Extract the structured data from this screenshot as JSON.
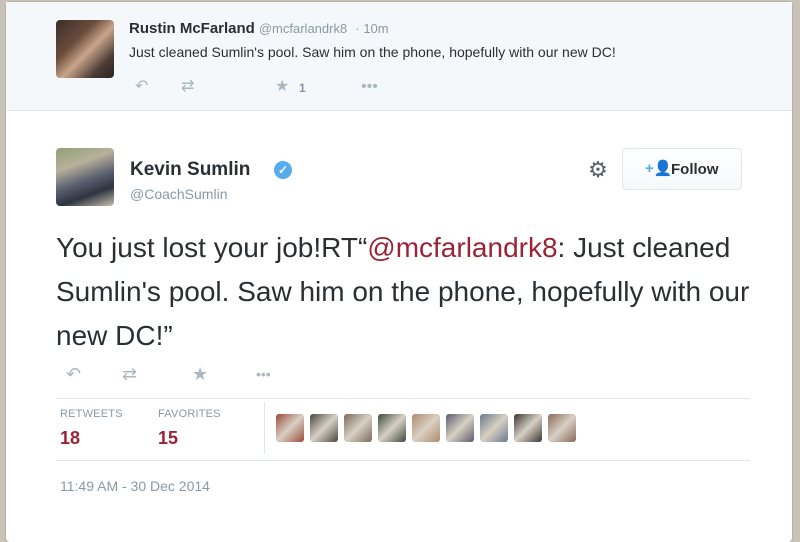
{
  "reply": {
    "fullname": "Rustin McFarland",
    "handle": "@mcfarlandrk8",
    "time": "· 10m",
    "text": "Just cleaned Sumlin's pool. Saw him on the phone, hopefully with our new DC!",
    "favorite_count": "1",
    "icons": [
      "reply-icon",
      "retweet-icon",
      "star-icon",
      "more-icon"
    ]
  },
  "main": {
    "fullname": "Kevin Sumlin",
    "handle": "@CoachSumlin",
    "follow_label": "Follow",
    "text_before": "You just lost your job!RT“",
    "mention": "@mcfarlandrk8",
    "text_after": ": Just cleaned Sumlin's pool. Saw him on the phone, hopefully with our new DC!”",
    "stats": {
      "retweets_label": "RETWEETS",
      "retweets": "18",
      "favorites_label": "FAVORITES",
      "favorites": "15"
    },
    "favoriters": [
      {
        "color": "#9a4a3a"
      },
      {
        "color": "#4a4640"
      },
      {
        "color": "#7a6a5c"
      },
      {
        "color": "#3d4a3e"
      },
      {
        "color": "#b08a6a"
      },
      {
        "color": "#5a5a6a"
      },
      {
        "color": "#6a7a8a"
      },
      {
        "color": "#3a3632"
      },
      {
        "color": "#8a6a5a"
      }
    ],
    "timestamp": "11:49 AM - 30 Dec 2014"
  },
  "colors": {
    "link": "#9b2335",
    "verified": "#55acee",
    "muted": "#8899a6"
  }
}
